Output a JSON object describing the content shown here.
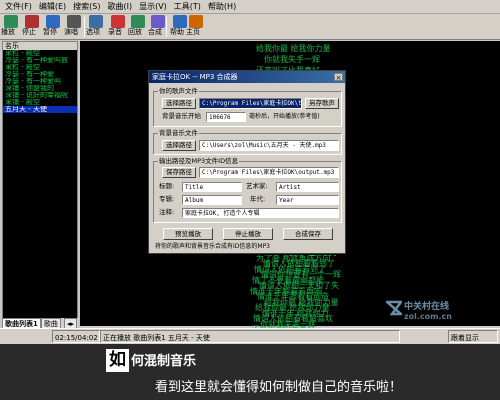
{
  "menu": [
    "文件(F)",
    "编辑(E)",
    "搜索(S)",
    "歌曲(I)",
    "显示(V)",
    "工具(T)",
    "帮助(H)"
  ],
  "toolbar": [
    {
      "label": "播放",
      "icon": "play-icon",
      "color": "#2e8b57"
    },
    {
      "label": "停止",
      "icon": "stop-icon",
      "color": "#b03030"
    },
    {
      "label": "暂停",
      "icon": "pause-icon",
      "color": "#2e6bbf"
    },
    {
      "label": "演唱",
      "icon": "microphone-icon",
      "color": "#555"
    },
    {
      "label": "选项",
      "icon": "options-icon",
      "color": "#3a6ea5"
    },
    {
      "label": "录音",
      "icon": "record-icon",
      "color": "#cc3333"
    },
    {
      "label": "回放",
      "icon": "replay-icon",
      "color": "#2e8b57"
    },
    {
      "label": "合成",
      "icon": "mix-icon",
      "color": "#6a5acd"
    },
    {
      "label": "帮助",
      "icon": "help-icon",
      "color": "#2e6bbf"
    },
    {
      "label": "主页",
      "icon": "home-icon",
      "color": "#cc6600"
    }
  ],
  "playlist": {
    "header": "名乐",
    "items": [
      {
        "text": "采粒 - 殿空",
        "selected": false
      },
      {
        "text": "冷瑟 - 有一种爱叫放",
        "selected": false
      },
      {
        "text": "采粒 - 殿空",
        "selected": false
      },
      {
        "text": "冷瑟 - 有一种爱",
        "selected": false
      },
      {
        "text": "冷瑟 - 有一种爱叫",
        "selected": false
      },
      {
        "text": "深铺 - 你是我的",
        "selected": false
      },
      {
        "text": "深铺 - 说好的幸福呢",
        "selected": false
      },
      {
        "text": "采铺 - 殿空",
        "selected": false
      },
      {
        "text": "五月天 - 天使",
        "selected": true
      }
    ],
    "tabs": [
      "歌曲列表1",
      "歌曲"
    ]
  },
  "lyrics": [
    {
      "text": "给我你最 给我你力量",
      "hl": false
    },
    {
      "text": "你就我失手一辉",
      "hl": false
    },
    {
      "text": "还来叫了比我真好",
      "hl": false
    },
    {
      "text": "给我你最 给我你力量",
      "hl": false
    },
    {
      "text": "情谊人依相看看到了",
      "hl": false
    },
    {
      "text": "你就我失手一辉",
      "hl": false
    },
    {
      "text": "还来叫了比我真好",
      "hl": false
    },
    {
      "text": "情谊人依相看看到了",
      "hl": false
    },
    {
      "text": "唱着歌 给我会放在小心",
      "hl": false
    },
    {
      "text": "叫你中我心 在一天学",
      "hl": true
    },
    {
      "text": "为了会 那就再成方向",
      "hl": false
    },
    {
      "text": "情谊人依相看看到了",
      "hl": false
    },
    {
      "text": "情谊人依相看看到了",
      "hl": false
    },
    {
      "text": "情谊你想要有一个一辉",
      "hl": false
    },
    {
      "text": "情了不要着最幽都能",
      "hl": false
    },
    {
      "text": "情谊人依相一天和了失",
      "hl": false
    },
    {
      "text": "情谁千年解看看再响",
      "hl": false
    },
    {
      "text": "情谁千年跟着看创造",
      "hl": false
    },
    {
      "text": "给我你最 给我你力量",
      "hl": false
    },
    {
      "text": "给我你最 给我你力量",
      "hl": false
    },
    {
      "text": "情谁千年 给我你力",
      "hl": false
    },
    {
      "text": "情谊人依相看看最喜欢",
      "hl": false
    },
    {
      "text": "你就我失手一辉",
      "hl": false
    },
    {
      "text": "还来叫了比我真好",
      "hl": false
    }
  ],
  "dialog": {
    "title": "家庭卡拉OK -- MP3 合成器",
    "close": "×",
    "vocal_group": "你的歌声文件",
    "vocal_btn": "选择路径",
    "vocal_path": "C:\\Program Files\\家庭卡拉OK\\temp.wav",
    "save_as_btn": "另存歌声",
    "bg_start_label": "背景音乐开始",
    "bg_start_value": "106676",
    "bg_start_hint": "毫秒后，开始播放(参考值)",
    "bg_group": "背景音乐文件",
    "bg_btn": "选择路径",
    "bg_path": "C:\\Users\\zol\\Music\\五月天 - 天使.mp3",
    "out_group": "输出路径及MP3文件ID信息",
    "out_btn": "保存路径",
    "out_path": "C:\\Program Files\\家庭卡拉OK\\output.mp3",
    "title_label": "标题:",
    "title_value": "Title",
    "artist_label": "艺术家:",
    "artist_value": "Artist",
    "album_label": "专辑:",
    "album_value": "Album",
    "year_label": "年代:",
    "year_value": "Year",
    "note_label": "注释:",
    "note_value": "家庭卡拉OK, 打造个人专辑",
    "preview_btn": "预览播放",
    "stop_btn": "停止播放",
    "save_btn": "合成保存",
    "footer_text": "将你的歌声和背景音乐合成有ID信息的MP3"
  },
  "status": {
    "time": "02:15/04:02",
    "song": "正在播放 歌曲列表1 五月天 - 天使",
    "right": "跟着显示"
  },
  "watermark": {
    "main": "中关村在线",
    "sub": "zol.com.cn"
  },
  "caption": {
    "first_char": "如",
    "title_rest": "何混制音乐",
    "subtitle": "看到这里就会懂得如何制做自己的音乐啦！"
  }
}
